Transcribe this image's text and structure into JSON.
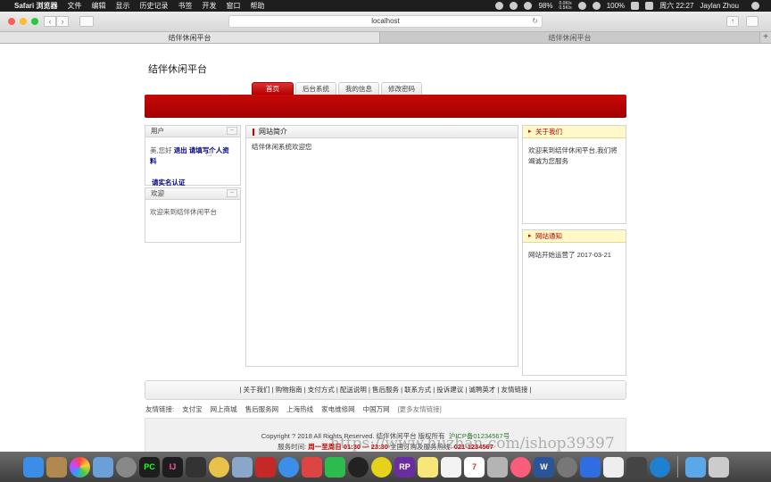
{
  "menubar": {
    "app_name": "Safari 浏览器",
    "items": [
      "文件",
      "编辑",
      "显示",
      "历史记录",
      "书签",
      "开发",
      "窗口",
      "帮助"
    ],
    "battery": "98%",
    "net_up": "0.0K/s",
    "net_down": "0.5K/s",
    "battery2": "100%",
    "datetime": "周六 22:27",
    "user": "Jaylan Zhou"
  },
  "browser": {
    "url": "localhost",
    "tabs": [
      {
        "label": "结伴休闲平台",
        "active": true
      },
      {
        "label": "结伴休闲平台",
        "active": false
      }
    ]
  },
  "site": {
    "title": "结伴休闲平台",
    "nav": [
      {
        "label": "首页",
        "active": true
      },
      {
        "label": "后台系统",
        "active": false
      },
      {
        "label": "我的信息",
        "active": false
      },
      {
        "label": "修改密码",
        "active": false
      }
    ]
  },
  "user_panel": {
    "title": "用户",
    "greeting": "美,您好",
    "logout": "退出",
    "fill_profile": "请填写个人资料",
    "verify": "请实名认证"
  },
  "welcome_panel": {
    "title": "欢迎",
    "text": "欢迎来到结伴休闲平台"
  },
  "intro_panel": {
    "title": "网站简介",
    "text": "结伴休闲系统欢迎您"
  },
  "about_panel": {
    "title": "关于我们",
    "text": "欢迎来到结伴休闲平台,我们将竭诚为您服务"
  },
  "notice_panel": {
    "title": "网站通知",
    "text": "网站开始运营了 2017-03-21"
  },
  "footer": {
    "links": [
      "关于我们",
      "购物指南",
      "支付方式",
      "配送说明",
      "售后服务",
      "联系方式",
      "投诉建议",
      "诚聘英才",
      "友情链接"
    ],
    "friend_label": "友情链接:",
    "friend_links": [
      "支付宝",
      "网上商城",
      "售后服务网",
      "上海热线",
      "家电维修网",
      "中国万网"
    ],
    "friend_more": "[更多友情链接]",
    "copyright": "Copyright ? 2018 All Rights Reserved. 结伴休闲平台 版权所有",
    "icp": "沪ICP备01234567号",
    "service_label": "服务时间:",
    "service_hours": "周一至周日 01:30 — 23:30",
    "hotline_label": "全国订购及服务热线:",
    "hotline": "021-1234567"
  },
  "watermark": "https://www.huzhan.com/ishop39397",
  "colors": {
    "brand_red": "#b50000",
    "link_blue": "#00008b",
    "notice_yellow": "#fff8c8"
  },
  "dock": [
    "Finder",
    "Launchpad",
    "Photos",
    "Preview",
    "Rocket",
    "PyCharm",
    "IntelliJ",
    "Sublime",
    "Bee",
    "Database",
    "Redis",
    "Safari",
    "Screen",
    "WeChat",
    "QQ",
    "Kite",
    "Axure RP",
    "Notes",
    "Stickies",
    "Calendar",
    "Tools",
    "Music",
    "Word",
    "Preferences",
    "Baidu",
    "Finder2",
    "Terminal",
    "Edge",
    "Folder",
    "Trash"
  ]
}
